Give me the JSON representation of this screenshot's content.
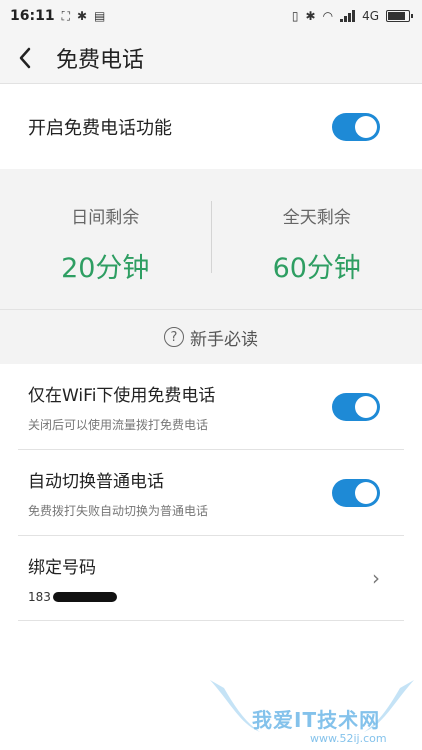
{
  "status_bar": {
    "time": "16:11",
    "network": "4G",
    "battery_level": 0.95
  },
  "header": {
    "title": "免费电话"
  },
  "master_toggle": {
    "label": "开启免费电话功能",
    "on": true
  },
  "stats": [
    {
      "label": "日间剩余",
      "value": "20分钟"
    },
    {
      "label": "全天剩余",
      "value": "60分钟"
    }
  ],
  "guide": {
    "icon": "?",
    "label": "新手必读"
  },
  "settings": {
    "wifi_only": {
      "title": "仅在WiFi下使用免费电话",
      "subtitle": "关闭后可以使用流量拨打免费电话",
      "on": true
    },
    "auto_switch": {
      "title": "自动切换普通电话",
      "subtitle": "免费拨打失败自动切换为普通电话",
      "on": true
    },
    "bind_number": {
      "title": "绑定号码",
      "number_prefix": "183",
      "chevron": "›"
    }
  },
  "watermark": {
    "text": "我爱IT技术网",
    "url": "www.52ij.com"
  },
  "colors": {
    "accent_toggle": "#1e8ad6",
    "stat_green": "#2e9e62",
    "watermark_blue": "#6fb8e8"
  }
}
